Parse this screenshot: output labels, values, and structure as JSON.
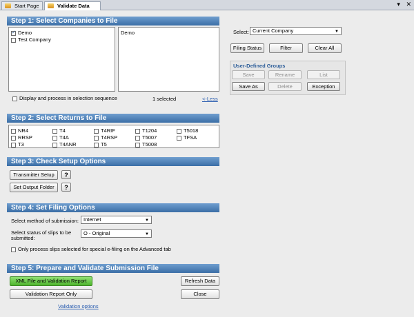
{
  "tabs": [
    {
      "label": "Start Page"
    },
    {
      "label": "Validate Data"
    }
  ],
  "window_controls": {
    "dropdown": "▾",
    "close": "✕"
  },
  "step1": {
    "title": "Step 1: Select Companies to File",
    "companies": [
      {
        "label": "Demo",
        "checked": true
      },
      {
        "label": "Test Company",
        "checked": false
      }
    ],
    "selected_list": [
      "Demo"
    ],
    "sequence_label": "Display and process in selection sequence",
    "selected_count": "1 selected",
    "less_link": "<-Less"
  },
  "right": {
    "select_label": "Select:",
    "select_value": "Current Company",
    "filing_status": "Filing Status",
    "filter": "Filter",
    "clear_all": "Clear All",
    "groups_title": "User-Defined Groups",
    "save": "Save",
    "rename": "Rename",
    "list": "List",
    "save_as": "Save As",
    "delete": "Delete",
    "exception": "Exception"
  },
  "step2": {
    "title": "Step 2: Select Returns to File",
    "returns": [
      [
        "NR4",
        "T4",
        "T4RIF",
        "T1204",
        "T5018"
      ],
      [
        "RRSP",
        "T4A",
        "T4RSP",
        "T5007",
        "TFSA"
      ],
      [
        "T3",
        "T4ANR",
        "T5",
        "T5008",
        ""
      ]
    ]
  },
  "step3": {
    "title": "Step 3: Check Setup Options",
    "transmitter": "Transmitter Setup",
    "output_folder": "Set Output Folder",
    "help": "?"
  },
  "step4": {
    "title": "Step 4: Set Filing Options",
    "method_label": "Select method of submission:",
    "method_value": "Internet",
    "status_label_1": "Select status of slips to be",
    "status_label_2": "submitted:",
    "status_value": "O - Original",
    "special_label": "Only process slips selected for special e-filing on the Advanced tab"
  },
  "step5": {
    "title": "Step 5: Prepare and Validate Submission File",
    "xml_button": "XML File and Validation Report",
    "report_only": "Validation Report Only",
    "options_link": "Validation options",
    "refresh": "Refresh Data",
    "close": "Close"
  },
  "colors": {
    "header_top": "#6f9ecf",
    "header_bottom": "#3b6ea6",
    "green_button": "#4fb52e"
  }
}
